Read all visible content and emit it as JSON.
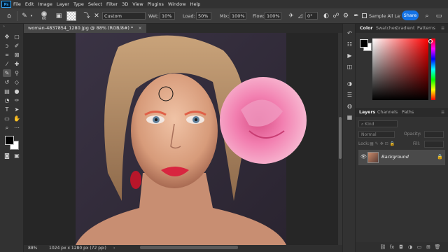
{
  "app": {
    "logo": "Ps"
  },
  "menu": [
    "File",
    "Edit",
    "Image",
    "Layer",
    "Type",
    "Select",
    "Filter",
    "3D",
    "View",
    "Plugins",
    "Window",
    "Help"
  ],
  "options": {
    "brush_size": "60",
    "preset": "Custom",
    "wet_label": "Wet:",
    "wet_value": "10%",
    "load_label": "Load:",
    "load_value": "50%",
    "mix_label": "Mix:",
    "mix_value": "100%",
    "flow_label": "Flow:",
    "flow_value": "100%",
    "angle_value": "0°",
    "sample_label": "Sample All Layers",
    "share_label": "Share"
  },
  "document": {
    "tab_title": "woman-4837854_1280.jpg @ 88% (RGB/8#) *",
    "zoom": "88%",
    "info": "1024 px x 1280 px (72 ppi)"
  },
  "color_panel": {
    "tabs": [
      "Color",
      "Swatches",
      "Gradient",
      "Patterns"
    ],
    "foreground_color": "#000000",
    "background_color": "#ffffff"
  },
  "layers_panel": {
    "tabs": [
      "Layers",
      "Channels",
      "Paths"
    ],
    "search_placeholder": "Kind",
    "blend_mode": "Normal",
    "opacity_label": "Opacity:",
    "lock_label": "Lock:",
    "fill_label": "Fill:",
    "layer_name": "Background"
  },
  "icons": {
    "home": "home-icon",
    "brush": "mixer-brush-icon",
    "lock": "lock-icon",
    "eye": "eye-icon"
  }
}
